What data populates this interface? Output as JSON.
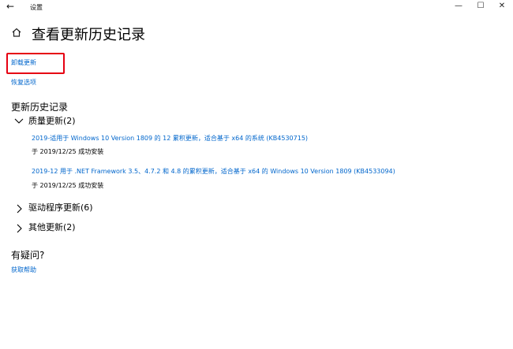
{
  "window": {
    "title": "设置",
    "back_icon": "←",
    "min_icon": "—",
    "max_icon": "☐",
    "close_icon": "✕"
  },
  "page": {
    "title": "查看更新历史记录"
  },
  "links": {
    "uninstall": "卸载更新",
    "recovery": "恢复选项"
  },
  "history": {
    "title": "更新历史记录",
    "groups": [
      {
        "label": "质量更新(2)",
        "expanded": true,
        "items": [
          {
            "name": "2019-适用于 Windows 10 Version 1809 的 12 累积更新，适合基于 x64 的系统 (KB4530715)",
            "status": "于 2019/12/25 成功安装"
          },
          {
            "name": "2019-12 用于 .NET Framework 3.5、4.7.2 和 4.8 的累积更新，适合基于 x64 的 Windows 10 Version 1809 (KB4533094)",
            "status": "于 2019/12/25 成功安装"
          }
        ]
      },
      {
        "label": "驱动程序更新(6)",
        "expanded": false,
        "items": []
      },
      {
        "label": "其他更新(2)",
        "expanded": false,
        "items": []
      }
    ]
  },
  "help": {
    "title": "有疑问?",
    "link": "获取帮助"
  },
  "colors": {
    "link": "#0066cc",
    "highlight_box": "#e60012"
  }
}
